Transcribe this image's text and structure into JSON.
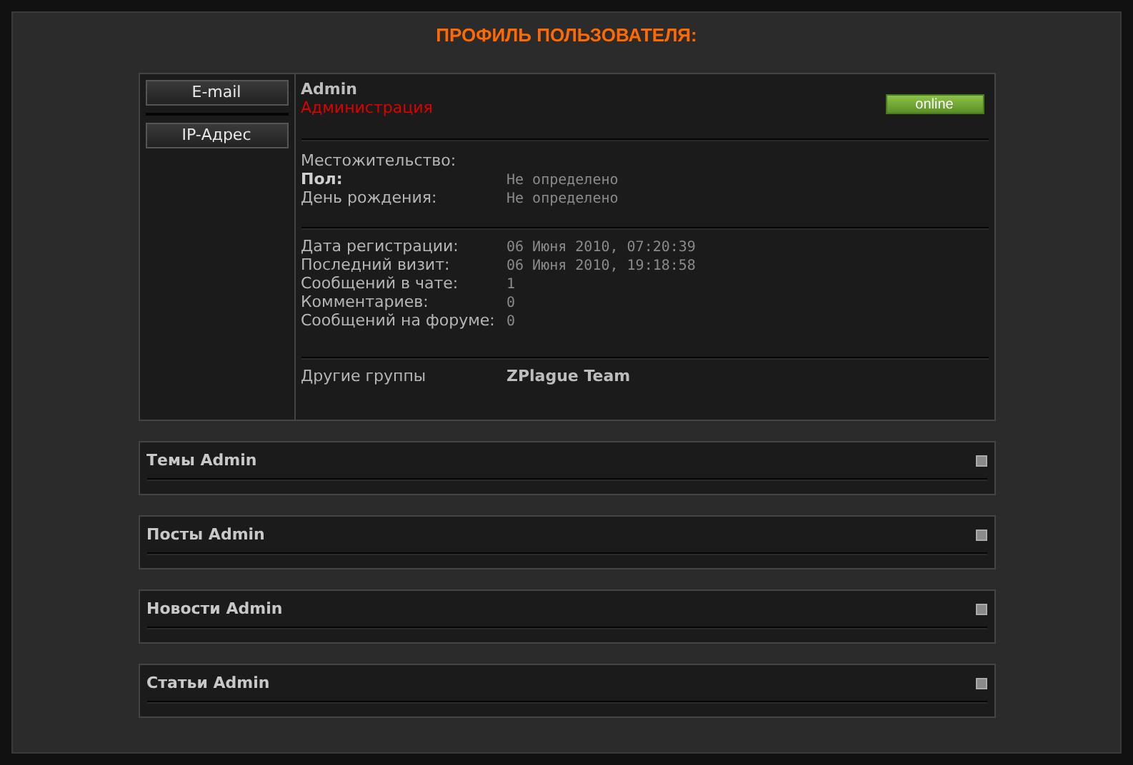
{
  "title": "ПРОФИЛЬ ПОЛЬЗОВАТЕЛЯ:",
  "side_buttons": [
    "E-mail",
    "IP-Адрес"
  ],
  "user": {
    "name": "Admin",
    "group": "Администрация",
    "status": "online"
  },
  "personal": [
    {
      "label": "Местожительство:",
      "bold": false
    },
    {
      "label": "Пол:",
      "value": "Не определено",
      "bold": true
    },
    {
      "label": "День рождения:",
      "value": "Не определено",
      "bold": false
    }
  ],
  "stats": [
    {
      "label": "Дата регистрации:",
      "value": "06 Июня 2010, 07:20:39"
    },
    {
      "label": "Последний визит:",
      "value": "06 Июня 2010, 19:18:58"
    },
    {
      "label": "Сообщений в чате:",
      "value": "1"
    },
    {
      "label": "Комментариев:",
      "value": "0"
    },
    {
      "label": "Сообщений на форуме:",
      "value": "0"
    }
  ],
  "other_groups": {
    "label": "Другие группы",
    "value": "ZPlague Team"
  },
  "sections": [
    "Темы Admin",
    "Посты Admin",
    "Новости Admin",
    "Статьи Admin"
  ]
}
